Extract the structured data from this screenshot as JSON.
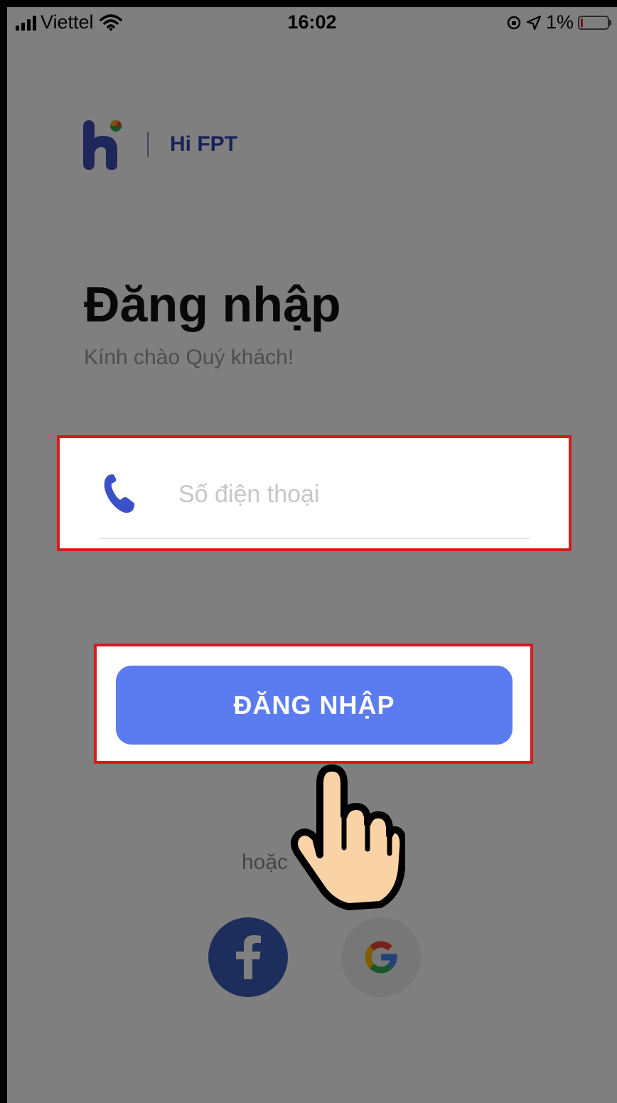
{
  "status_bar": {
    "carrier": "Viettel",
    "time": "16:02",
    "battery": "1%"
  },
  "app": {
    "brand": "Hi FPT"
  },
  "login": {
    "title": "Đăng nhập",
    "subtitle": "Kính chào Quý khách!",
    "phone_placeholder": "Số điện thoại",
    "phone_value": "",
    "button_label": "ĐĂNG NHẬP",
    "or_text": "hoặc"
  },
  "social": [
    {
      "name": "facebook-icon"
    },
    {
      "name": "google-icon"
    }
  ],
  "colors": {
    "accent": "#5a7cf0",
    "brand": "#3344b0",
    "highlight": "#d8191e",
    "facebook": "#3b5db8"
  }
}
